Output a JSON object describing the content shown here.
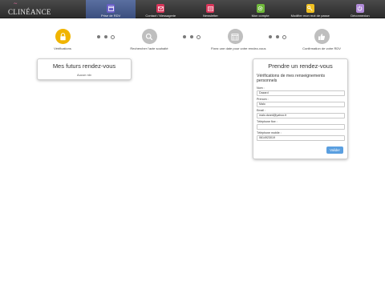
{
  "brand": {
    "logo_text": "CLINÉANCE",
    "logo_mark": "~"
  },
  "nav": {
    "items": [
      {
        "label": "Prise de RDV",
        "icon": "calendar-icon",
        "color": "#6a5fc8",
        "active": true
      },
      {
        "label": "Contact / Messagerie",
        "icon": "mail-icon",
        "color": "#d9365a"
      },
      {
        "label": "Newsletter",
        "icon": "newsletter-icon",
        "color": "#d9365a"
      },
      {
        "label": "Mon compte",
        "icon": "gear-icon",
        "color": "#6fb83a"
      },
      {
        "label": "Modifier mon mot de passe",
        "icon": "key-icon",
        "color": "#f0c020"
      },
      {
        "label": "Déconnexion",
        "icon": "logout-icon",
        "color": "#b08ad8"
      }
    ]
  },
  "steps": [
    {
      "label": "Vérifications",
      "icon": "lock-icon",
      "state": "current"
    },
    {
      "label": "Rechercher l'acte souhaité",
      "icon": "search-icon",
      "state": "pending"
    },
    {
      "label": "Fixez une date pour votre rendez-vous",
      "icon": "calendar-icon",
      "state": "pending"
    },
    {
      "label": "Confirmation de votre RDV",
      "icon": "thumbs-up-icon",
      "state": "pending"
    }
  ],
  "appointments": {
    "title": "Mes futurs rendez-vous",
    "empty_text": "Aucun rdv"
  },
  "booking": {
    "title": "Prendre un rendez-vous",
    "subtitle": "Vérifications de mes renseignements personnels",
    "fields": [
      {
        "label": "Nom :",
        "value": "Dazard"
      },
      {
        "label": "Prenom :",
        "value": "Malo"
      },
      {
        "label": "Email :",
        "value": "malo.dzard@yahoo.fr"
      },
      {
        "label": "Téléphone fixe :",
        "value": ""
      },
      {
        "label": "Téléphone mobile :",
        "value": "0614923019"
      }
    ],
    "submit_label": "Valider"
  },
  "colors": {
    "accent": "#5a9fe0",
    "step_active": "#f0b400",
    "step_inactive": "#bfbfbf"
  }
}
